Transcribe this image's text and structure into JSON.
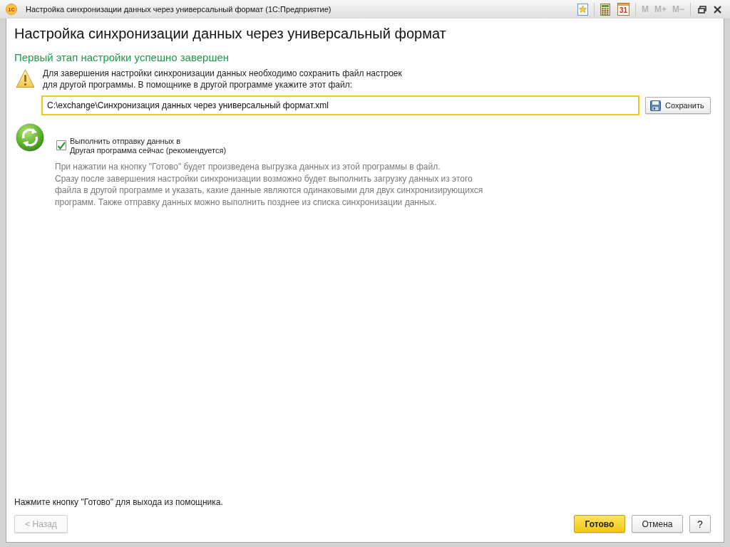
{
  "window": {
    "title": "Настройка синхронизации данных через универсальный формат (1С:Предприятие)",
    "logo_text": "1С"
  },
  "toolbar": {
    "calendar_day": "31",
    "memory_buttons": [
      {
        "label": "M",
        "disabled": true
      },
      {
        "label": "M+",
        "disabled": true
      },
      {
        "label": "M−",
        "disabled": true
      }
    ]
  },
  "heading": "Настройка синхронизации данных через универсальный формат",
  "stage_title": "Первый этап настройки успешно завершен",
  "instruction_lines": [
    "Для завершения настройки синхронизации данных необходимо сохранить файл настроек",
    "для другой программы. В помощнике в другой программе укажите этот файл:"
  ],
  "file_field": {
    "value": "C:\\exchange\\Синхронизация данных через универсальный формат.xml",
    "focused": true
  },
  "save_button": {
    "label": "Сохранить"
  },
  "send_now": {
    "label_lines": [
      "Выполнить отправку данных в",
      "Другая программа сейчас (рекомендуется)"
    ],
    "checked": true
  },
  "description_lines": [
    "При нажатии на кнопку \"Готово\" будет произведена выгрузка данных из этой программы в файл.",
    "Сразу после завершения настройки синхронизации возможно будет выполнить загрузку данных из этого",
    "файла в другой программе и указать, какие данные являются одинаковыми для двух синхронизирующихся",
    "программ. Также отправку данных можно выполнить позднее из списка синхронизации данных."
  ],
  "footer_hint": "Нажмите кнопку \"Готово\" для выхода из помощника.",
  "buttons": [
    {
      "label": "< Назад",
      "kind": "back",
      "disabled": true
    },
    {
      "label": "Готово",
      "kind": "default",
      "disabled": false
    },
    {
      "label": "Отмена",
      "kind": "normal",
      "disabled": false
    },
    {
      "label": "?",
      "kind": "help",
      "disabled": false
    }
  ]
}
